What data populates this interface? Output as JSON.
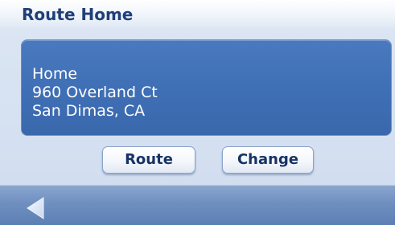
{
  "header": {
    "title": "Route Home"
  },
  "address": {
    "name": "Home",
    "street": "960 Overland Ct",
    "city_state": "San Dimas, CA"
  },
  "buttons": {
    "route_label": "Route",
    "change_label": "Change"
  },
  "footer": {
    "back_icon": "back-arrow-icon"
  },
  "colors": {
    "title": "#1f3f79",
    "panel": "#4173b8",
    "body_bg": "#d6e1f1",
    "footer_bg": "#6f8fc0",
    "button_text": "#163366"
  }
}
